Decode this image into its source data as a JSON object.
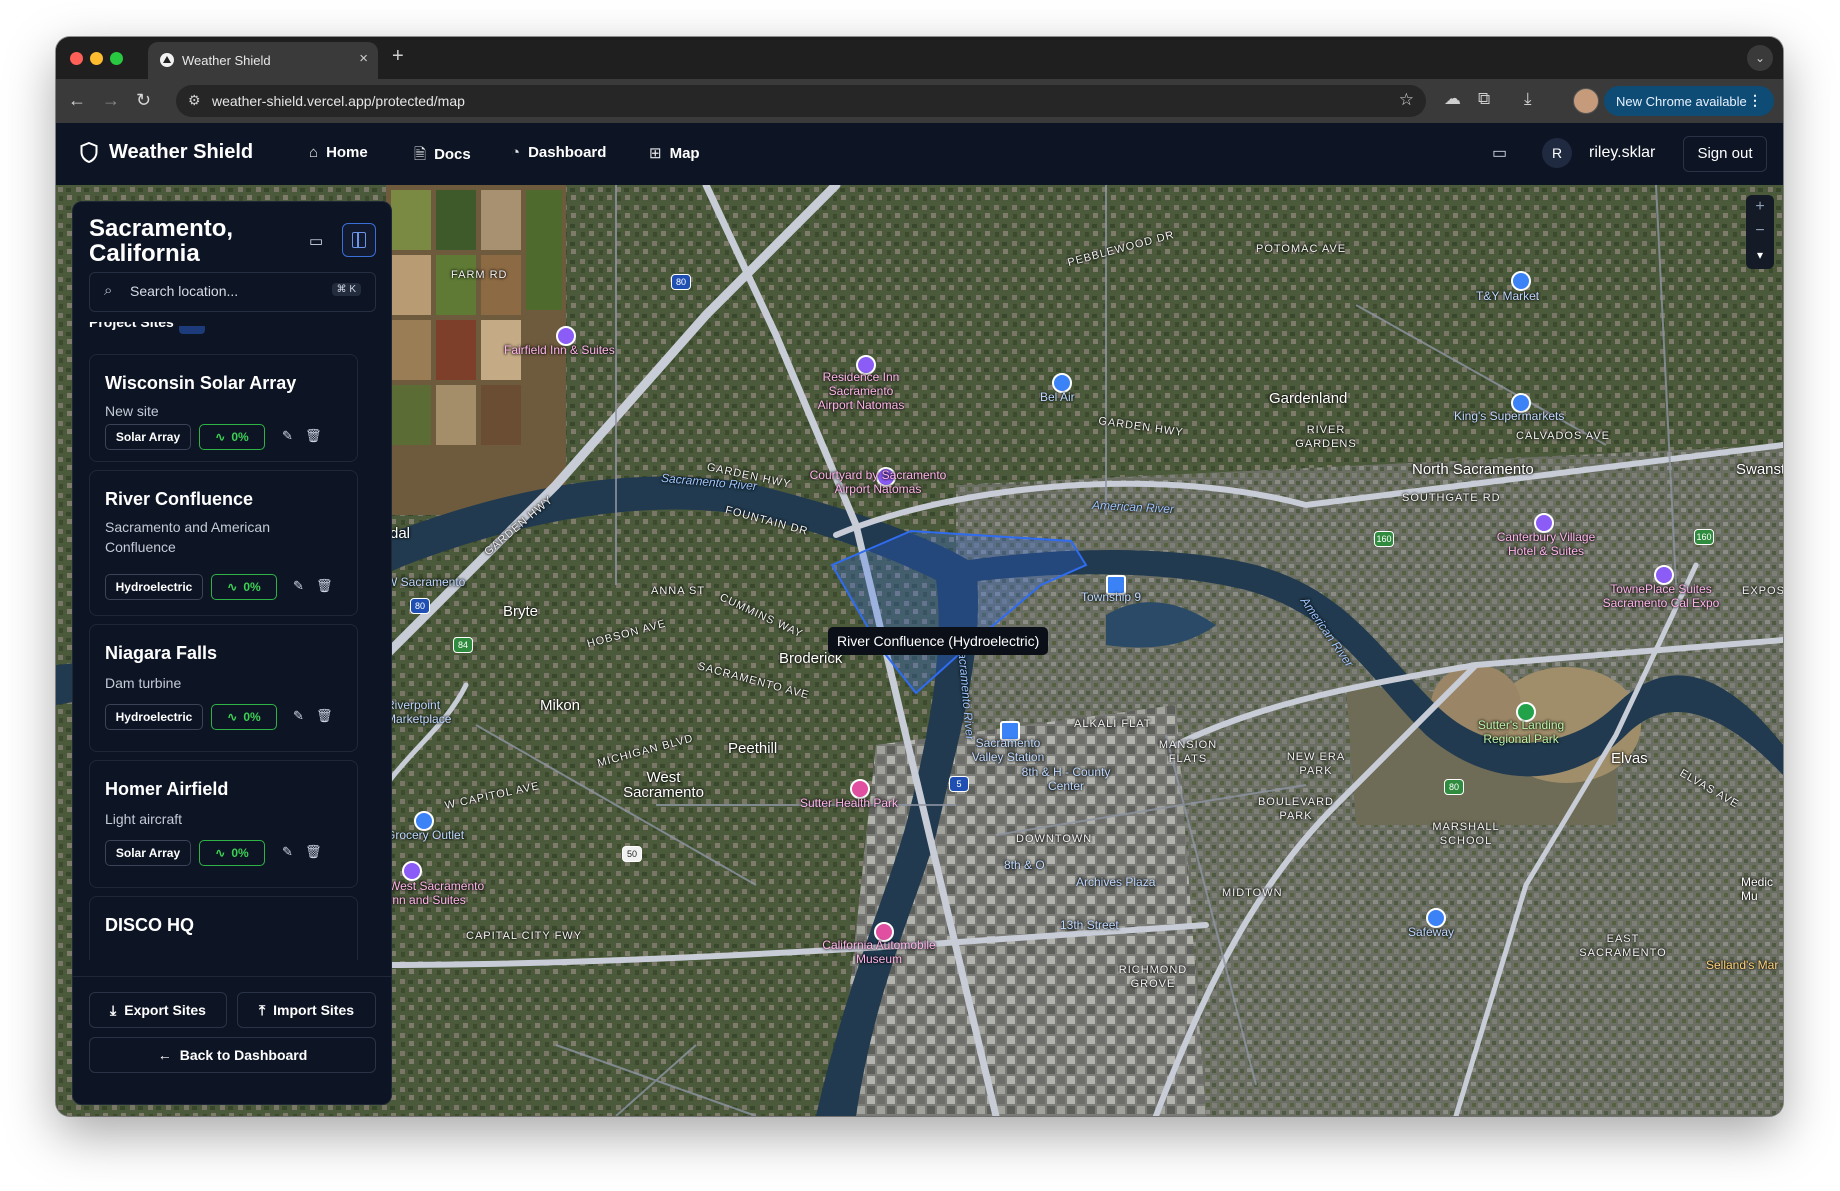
{
  "browser": {
    "tab_title": "Weather Shield",
    "tab_close": "×",
    "new_tab": "+",
    "url": "weather-shield.vercel.app/protected/map",
    "update_label": "New Chrome available",
    "update_more": "⋮"
  },
  "header": {
    "brand": "Weather Shield",
    "nav": [
      {
        "label": "Home",
        "icon": "home-icon",
        "glyph": "⌂"
      },
      {
        "label": "Docs",
        "icon": "document-icon",
        "glyph": "🗎"
      },
      {
        "label": "Dashboard",
        "icon": "chart-pie-icon",
        "glyph": "◔"
      },
      {
        "label": "Map",
        "icon": "map-icon",
        "glyph": "⊞"
      }
    ],
    "avatar_initial": "R",
    "username": "riley.sklar",
    "sign_out": "Sign out"
  },
  "sidebar": {
    "title": "Sacramento, California",
    "search_placeholder": "Search location...",
    "search_shortcut": "⌘ K",
    "section_title": "Project Sites",
    "sites": [
      {
        "name": "Wisconsin Solar Array",
        "description": "New site",
        "type": "Solar Array",
        "percent": "0%"
      },
      {
        "name": "River Confluence",
        "description": "Sacramento and American Confluence",
        "type": "Hydroelectric",
        "percent": "0%"
      },
      {
        "name": "Niagara Falls",
        "description": "Dam turbine",
        "type": "Hydroelectric",
        "percent": "0%"
      },
      {
        "name": "Homer Airfield",
        "description": "Light aircraft",
        "type": "Solar Array",
        "percent": "0%"
      },
      {
        "name": "DISCO HQ"
      }
    ],
    "export_label": "Export Sites",
    "import_label": "Import Sites",
    "back_label": "Back to Dashboard"
  },
  "map": {
    "tooltip": "River Confluence (Hydroelectric)",
    "zoom_in": "+",
    "zoom_out": "−",
    "labels": {
      "gardenland": "Gardenland",
      "north_sacramento": "North Sacramento",
      "broderick": "Broderick",
      "bryte": "Bryte",
      "west_sacramento": "West Sacramento",
      "mikon": "Mikon",
      "peethill": "Peethill",
      "elvas": "Elvas",
      "river_gardens": "RIVER GARDENS",
      "downtown": "DOWNTOWN",
      "midtown": "MIDTOWN",
      "marshall_school": "MARSHALL SCHOOL",
      "alkali_flat": "ALKALI FLAT",
      "mansion_flats": "MANSION FLATS",
      "new_era_park": "NEW ERA PARK",
      "boulevard_park": "BOULEVARD PARK",
      "east_sacramento": "EAST SACRAMENTO",
      "richmond_grove": "RICHMOND GROVE",
      "sacramento_river": "Sacramento River",
      "american_river": "American River",
      "american_river_2": "American River",
      "sacramento_river_2": "Sacramento River",
      "garden_hwy": "GARDEN HWY",
      "garden_hwy_2": "GARDEN HWY",
      "garden_hwy_3": "GARDEN HWY",
      "fountain_dr": "FOUNTAIN DR",
      "sacramento_ave": "SACRAMENTO AVE",
      "capitol_city_fwy": "CAPITAL CITY FWY",
      "w_capitol_ave": "W CAPITOL AVE",
      "michigan_blvd": "MICHIGAN BLVD",
      "cummins_way": "CUMMINS WAY",
      "hobson_ave": "HOBSON AVE",
      "anna_st": "ANNA ST",
      "southgate_rd": "SOUTHGATE RD",
      "calvados_ave": "CALVADOS AVE",
      "potomac_ave": "POTOMAC AVE",
      "pebblewood_dr": "PEBBLEWOOD DR",
      "farm_rd": "FARM RD",
      "elvas_ave": "ELVAS AVE",
      "fairfield_inn": "Fairfield Inn & Suites",
      "residence_inn": "Residence Inn Sacramento Airport Natomas",
      "courtyard": "Courtyard by Sacramento Airport Natomas",
      "bel_air": "Bel Air",
      "ty_market": "T&Y Market",
      "kings_supermarkets": "King's Supermarkets",
      "canterbury": "Canterbury Village Hotel & Suites",
      "towneplace": "TownePlace Suites Sacramento Cal Expo",
      "township9": "Township 9",
      "sutters_landing": "Sutter's Landing Regional Park",
      "sacramento_valley_station": "Sacramento Valley Station",
      "8th_h": "8th & H - County Center",
      "8th_o": "8th & O",
      "archives_plaza": "Archives Plaza",
      "13th_street": "13th Street",
      "sutter_health_park": "Sutter Health Park",
      "grocery_outlet": "Grocery Outlet",
      "west_sac_inn": "West Sacramento Inn and Suites",
      "automobile_museum": "California Automobile Museum",
      "safeway": "Safeway",
      "riverpoint": "Riverpoint Marketplace",
      "w_sacramento": "W Sacramento",
      "dal": "dal",
      "swanston": "Swanst",
      "expos": "EXPOS",
      "sellands": "Selland's Mar",
      "medical": "Medic Mu"
    },
    "shields": [
      "80",
      "160",
      "160",
      "80",
      "84",
      "50",
      "5",
      "80"
    ]
  },
  "colors": {
    "accent_blue": "#3b6fd8",
    "success_green": "#2fb344",
    "app_bg": "#0d1424",
    "polygon_blue": "#2f6cf0"
  }
}
